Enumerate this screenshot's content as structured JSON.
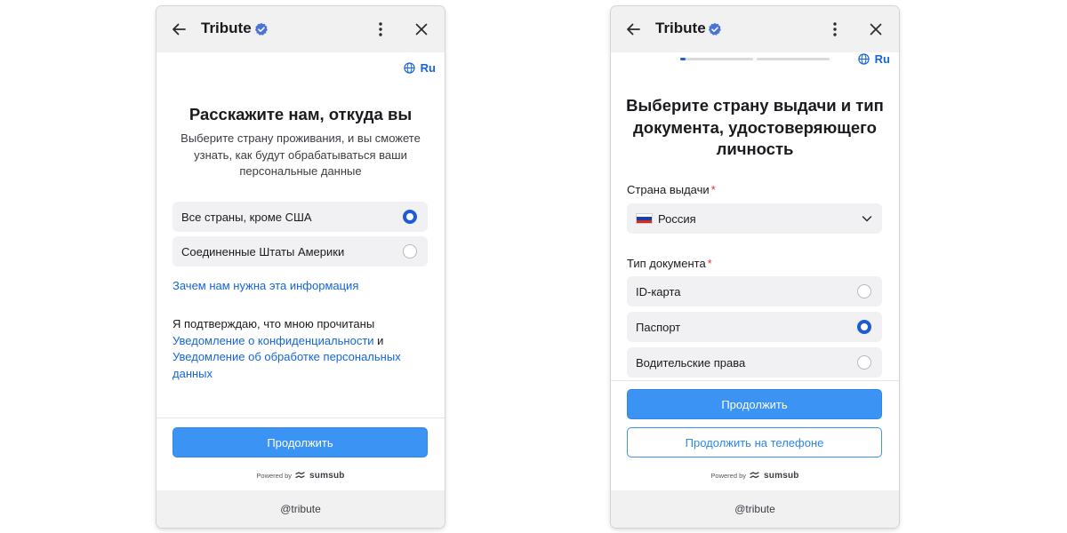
{
  "screen1": {
    "app_title": "Tribute",
    "language": "Ru",
    "heading": "Расскажите нам, откуда вы",
    "subtext": "Выберите страну проживания, и вы сможете узнать, как будут обрабатываться ваши персональные данные",
    "options": [
      {
        "label": "Все страны, кроме США",
        "selected": true
      },
      {
        "label": "Соединенные Штаты Америки",
        "selected": false
      }
    ],
    "why_link": "Зачем нам нужна эта информация",
    "consent_prefix": "Я подтверждаю, что мною прочитаны",
    "privacy_link": "Уведомление о конфиденциальности",
    "consent_and": " и",
    "processing_link": "Уведомление об обработке персональных данных",
    "continue_label": "Продолжить",
    "powered_by": "Powered by",
    "powered_brand": "sumsub",
    "footer_handle": "@tribute"
  },
  "screen2": {
    "app_title": "Tribute",
    "language": "Ru",
    "progress": {
      "step": 1,
      "total": 2,
      "current_fill_fraction": 0.07
    },
    "heading_lines": [
      "Выберите страну выдачи и тип",
      "документа, удостоверяющего",
      "личность"
    ],
    "country_label": "Страна выдачи",
    "required_mark": "*",
    "country_value": "Россия",
    "doc_type_label": "Тип документа",
    "doc_types": [
      {
        "label": "ID-карта",
        "selected": false
      },
      {
        "label": "Паспорт",
        "selected": true
      },
      {
        "label": "Водительские права",
        "selected": false
      }
    ],
    "continue_label": "Продолжить",
    "phone_label": "Продолжить на телефоне",
    "powered_by": "Powered by",
    "powered_brand": "sumsub",
    "footer_handle": "@tribute"
  },
  "colors": {
    "accent": "#1565d8",
    "primary_button": "#3b93f3",
    "radio_checked": "#1e5bd6",
    "header_bg": "#f1f1f2",
    "option_bg": "#f1f1f3",
    "required": "#e5322d"
  },
  "icons": {
    "back": "arrow-left-icon",
    "verified": "verified-badge-icon",
    "more": "more-vertical-icon",
    "close": "close-icon",
    "language": "globe-icon",
    "dropdown": "chevron-down-icon",
    "brand": "sumsub-logo-icon"
  }
}
